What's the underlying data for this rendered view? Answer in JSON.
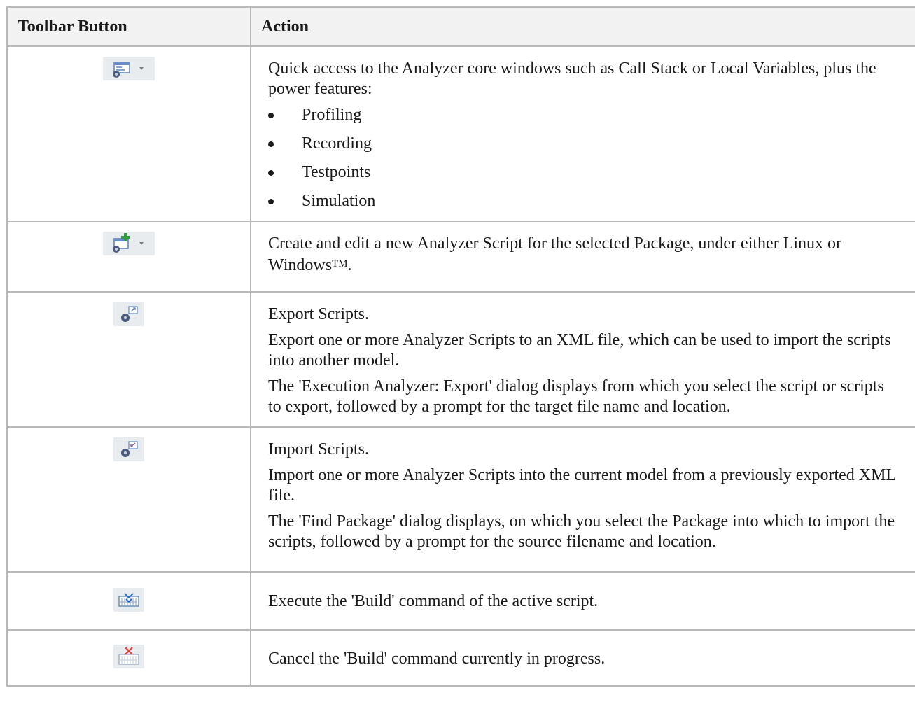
{
  "header": {
    "col_button": "Toolbar Button",
    "col_action": "Action"
  },
  "rows": [
    {
      "icon": "analyzer-windows-icon",
      "lines": [
        "Quick access to the Analyzer core windows such as Call Stack or Local Variables, plus the power features:"
      ],
      "features": [
        "Profiling",
        "Recording",
        "Testpoints",
        "Simulation"
      ]
    },
    {
      "icon": "new-script-icon",
      "lines": [
        "Create and edit a new Analyzer Script for the selected Package, under either Linux or Windows"
      ],
      "tm": "TM",
      "tm_end": "."
    },
    {
      "icon": "export-scripts-icon",
      "lines": [
        "Export Scripts.",
        "Export one or more Analyzer Scripts to an XML file, which can be used to import the scripts into another model.",
        "The 'Execution Analyzer: Export' dialog displays from which you select the script or scripts to export, followed by a prompt for the target file name and location."
      ]
    },
    {
      "icon": "import-scripts-icon",
      "lines": [
        "Import Scripts.",
        "Import one or more Analyzer Scripts into the current model from a previously exported XML file.",
        "The 'Find Package' dialog displays, on which you select the Package into which to import the scripts, followed by a prompt for the source filename and location."
      ]
    },
    {
      "icon": "build-icon",
      "lines": [
        "Execute the 'Build' command of the active script."
      ]
    },
    {
      "icon": "cancel-build-icon",
      "lines": [
        "Cancel the 'Build' command currently in progress."
      ]
    }
  ]
}
